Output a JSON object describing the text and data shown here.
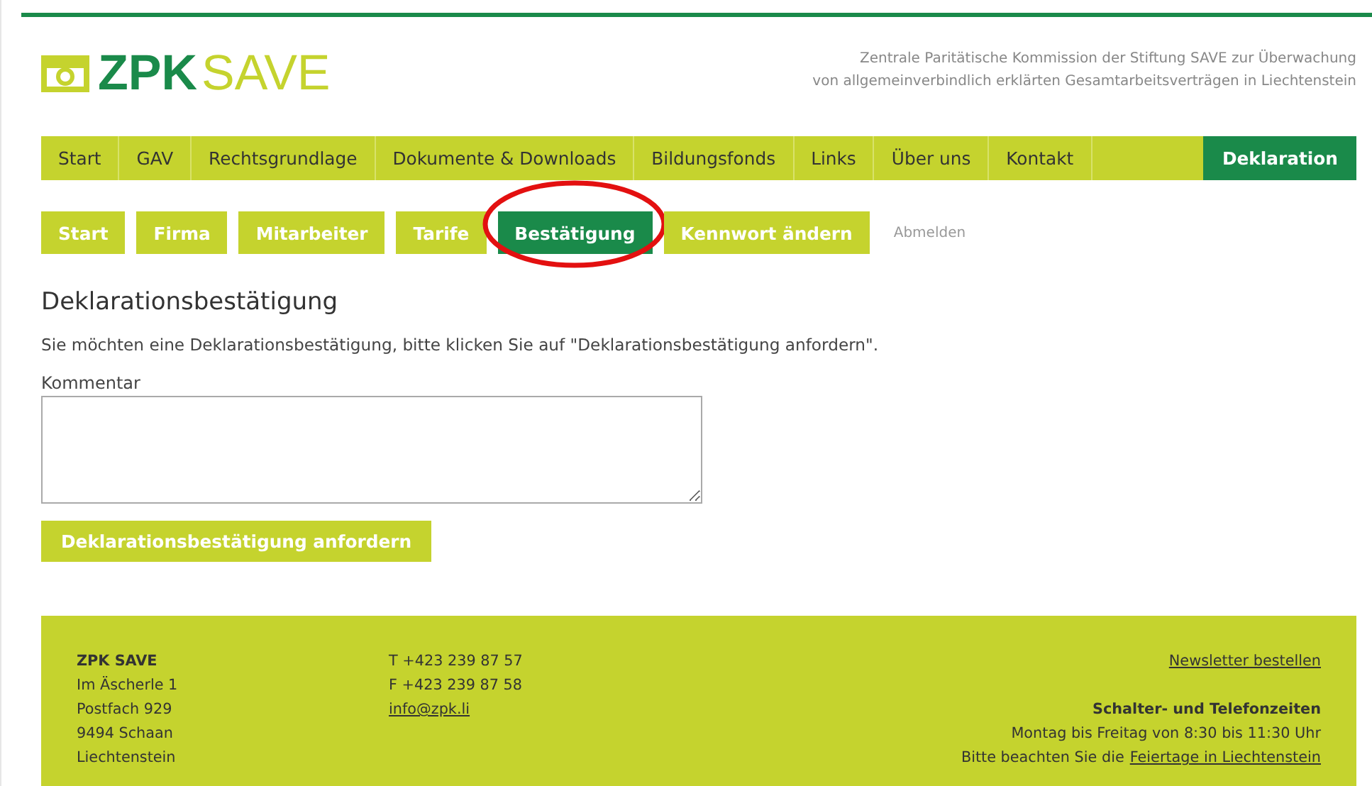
{
  "logo": {
    "part1": "ZPK",
    "part2": "SAVE"
  },
  "tagline": [
    "Zentrale Paritätische Kommission der Stiftung SAVE zur Überwachung",
    "von allgemeinverbindlich erklärten Gesamtarbeitsverträgen in Liechtenstein"
  ],
  "main_nav": [
    {
      "label": "Start",
      "selected": false
    },
    {
      "label": "GAV",
      "selected": false
    },
    {
      "label": "Rechtsgrundlage",
      "selected": false
    },
    {
      "label": "Dokumente & Downloads",
      "selected": false
    },
    {
      "label": "Bildungsfonds",
      "selected": false
    },
    {
      "label": "Links",
      "selected": false
    },
    {
      "label": "Über uns",
      "selected": false
    },
    {
      "label": "Kontakt",
      "selected": false
    },
    {
      "label": "Deklaration",
      "selected": true
    }
  ],
  "sub_nav": [
    {
      "label": "Start",
      "selected": false,
      "circled": false
    },
    {
      "label": "Firma",
      "selected": false,
      "circled": false
    },
    {
      "label": "Mitarbeiter",
      "selected": false,
      "circled": false
    },
    {
      "label": "Tarife",
      "selected": false,
      "circled": false
    },
    {
      "label": "Bestätigung",
      "selected": true,
      "circled": true
    },
    {
      "label": "Kennwort ändern",
      "selected": false,
      "circled": false
    }
  ],
  "logout": "Abmelden",
  "heading": "Deklarationsbestätigung",
  "intro": "Sie möchten eine Deklarationsbestätigung, bitte klicken Sie auf \"Deklarationsbestätigung anfordern\".",
  "comment_label": "Kommentar",
  "submit": "Deklarationsbestätigung anfordern",
  "footer": {
    "address": [
      "ZPK SAVE",
      "Im Äscherle 1",
      "Postfach 929",
      "9494 Schaan",
      "Liechtenstein"
    ],
    "phone": "T +423 239 87 57",
    "fax": "F +423 239 87 58",
    "email": "info@zpk.li",
    "newsletter": "Newsletter bestellen",
    "hours_title": "Schalter- und Telefonzeiten",
    "hours": "Montag bis Freitag von 8:30 bis 11:30 Uhr",
    "holidays_prefix": "Bitte beachten Sie die",
    "holidays_link": "Feiertage in Liechtenstein"
  }
}
